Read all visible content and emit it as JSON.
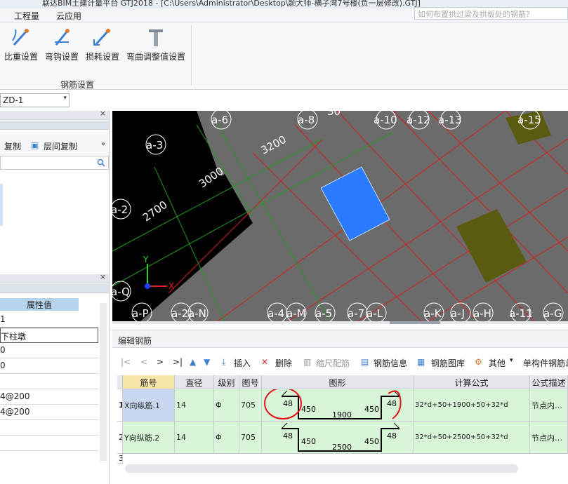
{
  "titlebar": {
    "title": "联达BIM土建计量平台 GTJ2018 - [C:\\Users\\Administrator\\Desktop\\颜大师-横子湾7号楼(负一层修改).GTJ]"
  },
  "menu": {
    "items": [
      "工程量",
      "云应用"
    ]
  },
  "help": {
    "placeholder": "如何布置拱过梁及拱板处的钢筋？"
  },
  "ribbon": {
    "buttons": [
      {
        "label": "比重设置",
        "icon": "density-icon"
      },
      {
        "label": "弯钩设置",
        "icon": "hook-icon"
      },
      {
        "label": "损耗设置",
        "icon": "loss-icon"
      },
      {
        "label": "弯曲调整值设置",
        "icon": "bend-adjust-icon"
      }
    ],
    "group_label": "钢筋设置"
  },
  "combo": {
    "value": "ZD-1"
  },
  "leftpanel": {
    "copy_label": "复制",
    "floor_copy_label": "层间复制",
    "prop_header": "属性值",
    "props": [
      "1",
      "下柱墩",
      "0",
      "0",
      "",
      "4@200",
      "4@200"
    ]
  },
  "viewport": {
    "axis_labels": [
      "a-6",
      "a-8",
      "a-10",
      "a-12",
      "a-13",
      "a-15",
      "a-3",
      "a-2",
      "a-Q",
      "a-P",
      "a-2",
      "a-N",
      "a-4",
      "a-M",
      "a-5",
      "a-7",
      "a-L",
      "a-K",
      "a-J",
      "a-H",
      "a-11",
      "a-G"
    ],
    "dims": [
      "3200",
      "3000",
      "2700",
      "30"
    ],
    "axis_x": "X",
    "axis_y": "Y"
  },
  "editor": {
    "title": "编辑钢筋",
    "toolbar": {
      "nav": [
        "|<",
        "<",
        ">",
        ">|"
      ],
      "insert": "插入",
      "delete": "删除",
      "scale": "缩尺配筋",
      "info": "钢筋信息",
      "library": "钢筋图库",
      "other": "其他",
      "single": "单构件钢筋总"
    },
    "columns": [
      "筋号",
      "直径(mm)",
      "级别",
      "图号",
      "图形",
      "计算公式",
      "公式描述"
    ],
    "rows": [
      {
        "num": "1",
        "name": "X向纵筋.1",
        "dia": "14",
        "grade": "Φ",
        "fig": "705",
        "shape": {
          "hook": "48",
          "leg": "450",
          "len": "1900"
        },
        "formula": "32*d+50+1900+50+32*d",
        "desc": "节点内…"
      },
      {
        "num": "2",
        "name": "Y向纵筋.2",
        "dia": "14",
        "grade": "Φ",
        "fig": "705",
        "shape": {
          "hook": "48",
          "leg": "450",
          "len": "2500"
        },
        "formula": "32*d+50+2500+50+32*d",
        "desc": "节点内…"
      },
      {
        "num": "3"
      }
    ]
  }
}
